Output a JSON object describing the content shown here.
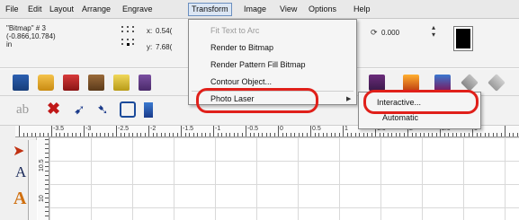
{
  "menubar": {
    "items": [
      "File",
      "Edit",
      "Layout",
      "Arrange",
      "Engrave",
      "Transform",
      "Image",
      "View",
      "Options",
      "Help"
    ],
    "open_item": "Transform"
  },
  "propbar": {
    "object_name": "\"Bitmap\" # 3",
    "position": "(-0.866,10.784)",
    "unit": "in",
    "x_label": "x:",
    "x_value": "0.54(",
    "y_label": "y:",
    "y_value": "7.68(",
    "rotation_value": "0.000"
  },
  "transform_menu": {
    "items": [
      {
        "label": "Fit Text to Arc",
        "disabled": true
      },
      {
        "label": "Render to Bitmap",
        "disabled": false
      },
      {
        "label": "Render Pattern Fill Bitmap",
        "disabled": false
      },
      {
        "label": "Contour Object...",
        "disabled": false
      },
      {
        "label": "Photo Laser",
        "disabled": false,
        "has_submenu": true
      }
    ]
  },
  "photo_laser_submenu": {
    "items": [
      "Interactive...",
      "Automatic"
    ]
  },
  "ruler": {
    "top_labels": [
      "-3.5",
      "-3",
      "-2.5",
      "-2",
      "-1.5",
      "-1",
      "-0.5",
      "0",
      "0.5",
      "1",
      "1.5",
      "2",
      "2.5",
      "3"
    ],
    "left_labels": [
      "10.5",
      "10"
    ]
  },
  "toolbar2": {
    "text_tool_label": "ab"
  },
  "colors": {
    "highlight_red": "#e0201a",
    "menu_open_bg": "#dbe6f4"
  }
}
